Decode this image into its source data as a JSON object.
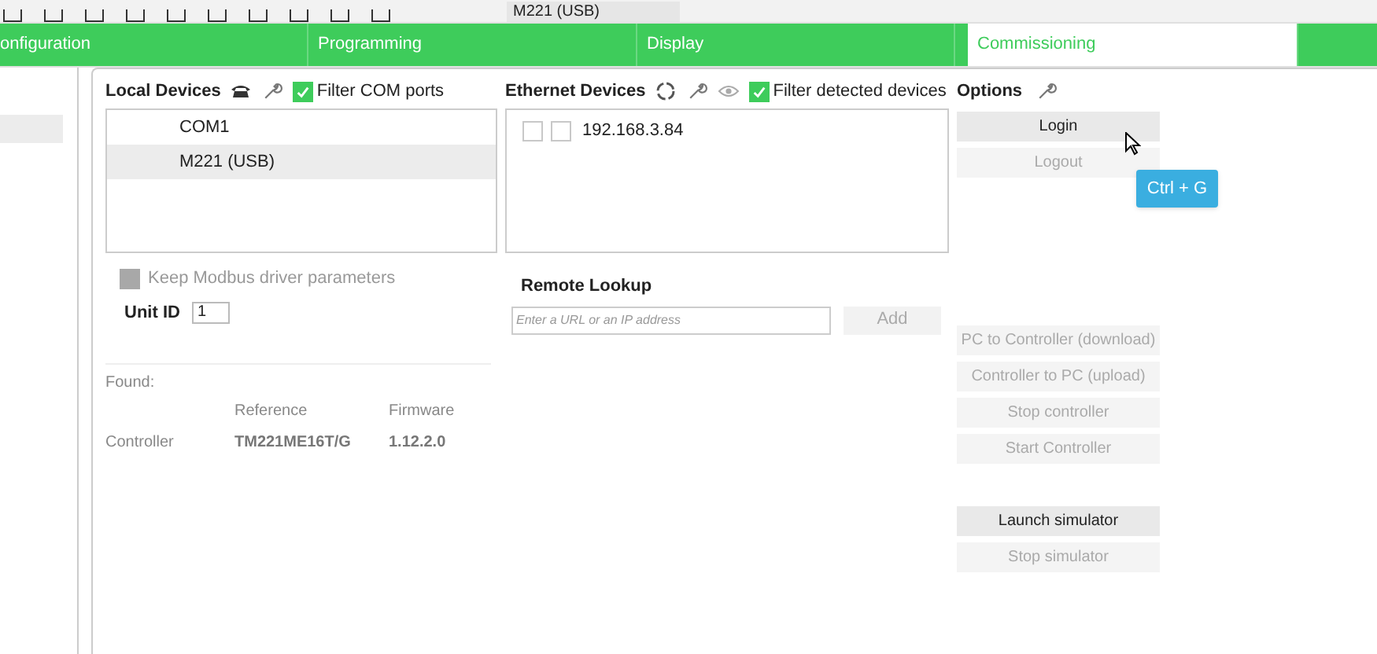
{
  "toolbar": {
    "device": "M221 (USB)"
  },
  "tabs": [
    {
      "label": "onfiguration",
      "selected": false
    },
    {
      "label": "Programming",
      "selected": false
    },
    {
      "label": "Display",
      "selected": false
    },
    {
      "label": "Commissioning",
      "selected": true
    }
  ],
  "local_devices": {
    "title": "Local Devices",
    "filter": {
      "label": "Filter COM ports",
      "checked": true
    },
    "items": [
      {
        "label": "COM1",
        "selected": false
      },
      {
        "label": "M221 (USB)",
        "selected": true
      }
    ],
    "keep_modbus": {
      "label": "Keep Modbus driver parameters",
      "checked": false,
      "disabled": true
    },
    "unit_id": {
      "label": "Unit ID",
      "value": "1"
    }
  },
  "found": {
    "label": "Found:",
    "columns": [
      "Reference",
      "Firmware"
    ],
    "rows": [
      {
        "name": "Controller",
        "reference": "TM221ME16T/G",
        "firmware": "1.12.2.0"
      }
    ]
  },
  "ethernet_devices": {
    "title": "Ethernet Devices",
    "filter": {
      "label": "Filter detected devices",
      "checked": true
    },
    "items": [
      {
        "address": "192.168.3.84",
        "checks": [
          false,
          false
        ]
      }
    ],
    "remote_lookup": {
      "title": "Remote Lookup",
      "placeholder": "Enter a URL or an IP address",
      "button": {
        "label": "Add",
        "disabled": true
      }
    }
  },
  "options": {
    "title": "Options",
    "tooltip": "Ctrl + G",
    "groups": [
      [
        {
          "label": "Login",
          "disabled": false
        },
        {
          "label": "Logout",
          "disabled": true
        }
      ],
      [
        {
          "label": "PC to Controller (download)",
          "disabled": true
        },
        {
          "label": "Controller to PC (upload)",
          "disabled": true
        },
        {
          "label": "Stop controller",
          "disabled": true
        },
        {
          "label": "Start Controller",
          "disabled": true
        }
      ],
      [
        {
          "label": "Launch simulator",
          "disabled": false
        },
        {
          "label": "Stop simulator",
          "disabled": true
        }
      ]
    ]
  }
}
